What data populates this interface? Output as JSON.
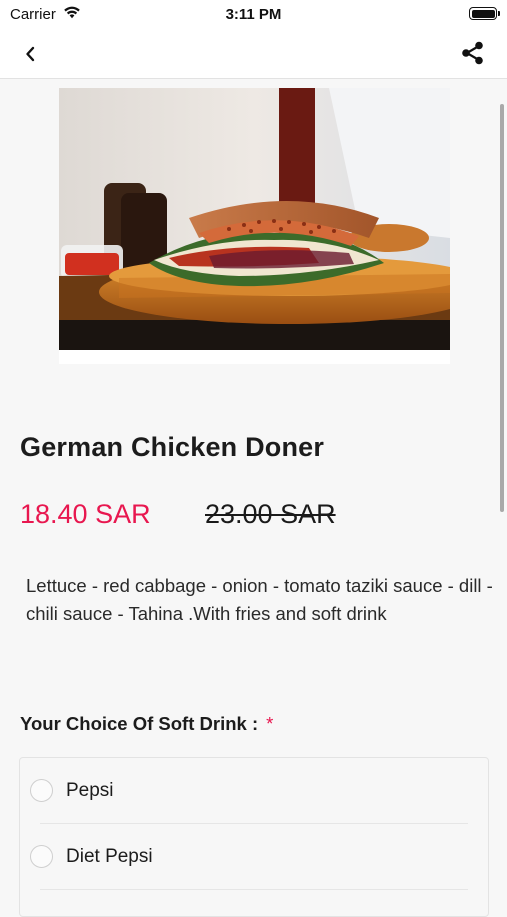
{
  "status_bar": {
    "carrier": "Carrier",
    "time": "3:11 PM",
    "wifi_icon": "wifi-icon",
    "battery_icon": "battery-icon"
  },
  "nav": {
    "back_icon": "chevron-left-icon",
    "share_icon": "share-icon"
  },
  "product": {
    "image_icon": "product-photo",
    "name": "German Chicken Doner",
    "sale_price": "18.40 SAR",
    "original_price": "23.00 SAR",
    "description": "Lettuce - red cabbage - onion - tomato taziki sauce - dill - chili sauce - Tahina .With fries and soft drink"
  },
  "option_group": {
    "title": "Your Choice Of Soft Drink :",
    "required_marker": "*",
    "options": [
      {
        "label": "Pepsi",
        "selected": false
      },
      {
        "label": "Diet Pepsi",
        "selected": false
      }
    ]
  },
  "colors": {
    "accent": "#e8174f",
    "background": "#f7f7f7",
    "bar_background": "#ffffff"
  }
}
